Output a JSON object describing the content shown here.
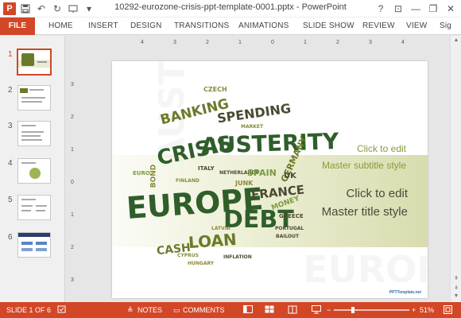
{
  "window": {
    "title": "10292-eurozone-crisis-ppt-template-0001.pptx - PowerPoint",
    "help_label": "?",
    "minimize_label": "—",
    "restore_label": "❐",
    "close_label": "✕",
    "ribbon_display_label": "⊡"
  },
  "qat": {
    "app_logo": "P",
    "save_icon": "💾",
    "undo_icon": "↶",
    "redo_icon": "↻",
    "more_icon": "▾"
  },
  "tabs": [
    "FILE",
    "HOME",
    "INSERT",
    "DESIGN",
    "TRANSITIONS",
    "ANIMATIONS",
    "SLIDE SHOW",
    "REVIEW",
    "VIEW",
    "Sig"
  ],
  "thumbnails": [
    {
      "num": "1"
    },
    {
      "num": "2"
    },
    {
      "num": "3"
    },
    {
      "num": "4"
    },
    {
      "num": "5"
    },
    {
      "num": "6"
    }
  ],
  "ruler": {
    "h_ticks": [
      "4",
      "3",
      "2",
      "1",
      "0",
      "1",
      "2",
      "3",
      "4"
    ],
    "v_ticks": [
      "3",
      "2",
      "1",
      "0",
      "1",
      "2",
      "3"
    ]
  },
  "slide": {
    "subtitle_line1": "Click to edit",
    "subtitle_line2": "Master subtitle style",
    "title_line1": "Click to edit",
    "title_line2": "Master title style",
    "brand": "PPTTemplate.net",
    "words": {
      "banking": "BANKING",
      "czech": "CZECH",
      "crisis": "CRISIS",
      "spending": "SPENDING",
      "austerity": "AUSTERITY",
      "europe": "EUROPE",
      "debt": "DEBT",
      "loan": "LOAN",
      "cash": "CASH",
      "france": "FRANCE",
      "germany": "GERMANY",
      "spain": "SPAIN",
      "money": "MONEY",
      "italy": "ITALY",
      "bond": "BOND",
      "uk": "UK",
      "greece": "GREECE",
      "junk": "JUNK",
      "inflation": "INFLATION",
      "hungary": "HUNGARY",
      "netherlands": "NETHERLANDS",
      "cyprus": "CYPRUS",
      "latvia": "LATVIA",
      "finland": "FINLAND",
      "portugal": "PORTUGAL",
      "euro": "EURO",
      "market": "MARKET",
      "bailout": "BAILOUT"
    }
  },
  "status": {
    "slide_info": "SLIDE 1 OF 6",
    "notes": "NOTES",
    "comments": "COMMENTS",
    "zoom": "51%",
    "zoom_fraction": 0.51,
    "zoom_minus": "−",
    "zoom_plus": "+"
  },
  "colors": {
    "accent": "#d24726",
    "cloud_dark": "#2f5e2a",
    "cloud_olive": "#6b7a2a",
    "subtitle": "#8a9a3a"
  }
}
